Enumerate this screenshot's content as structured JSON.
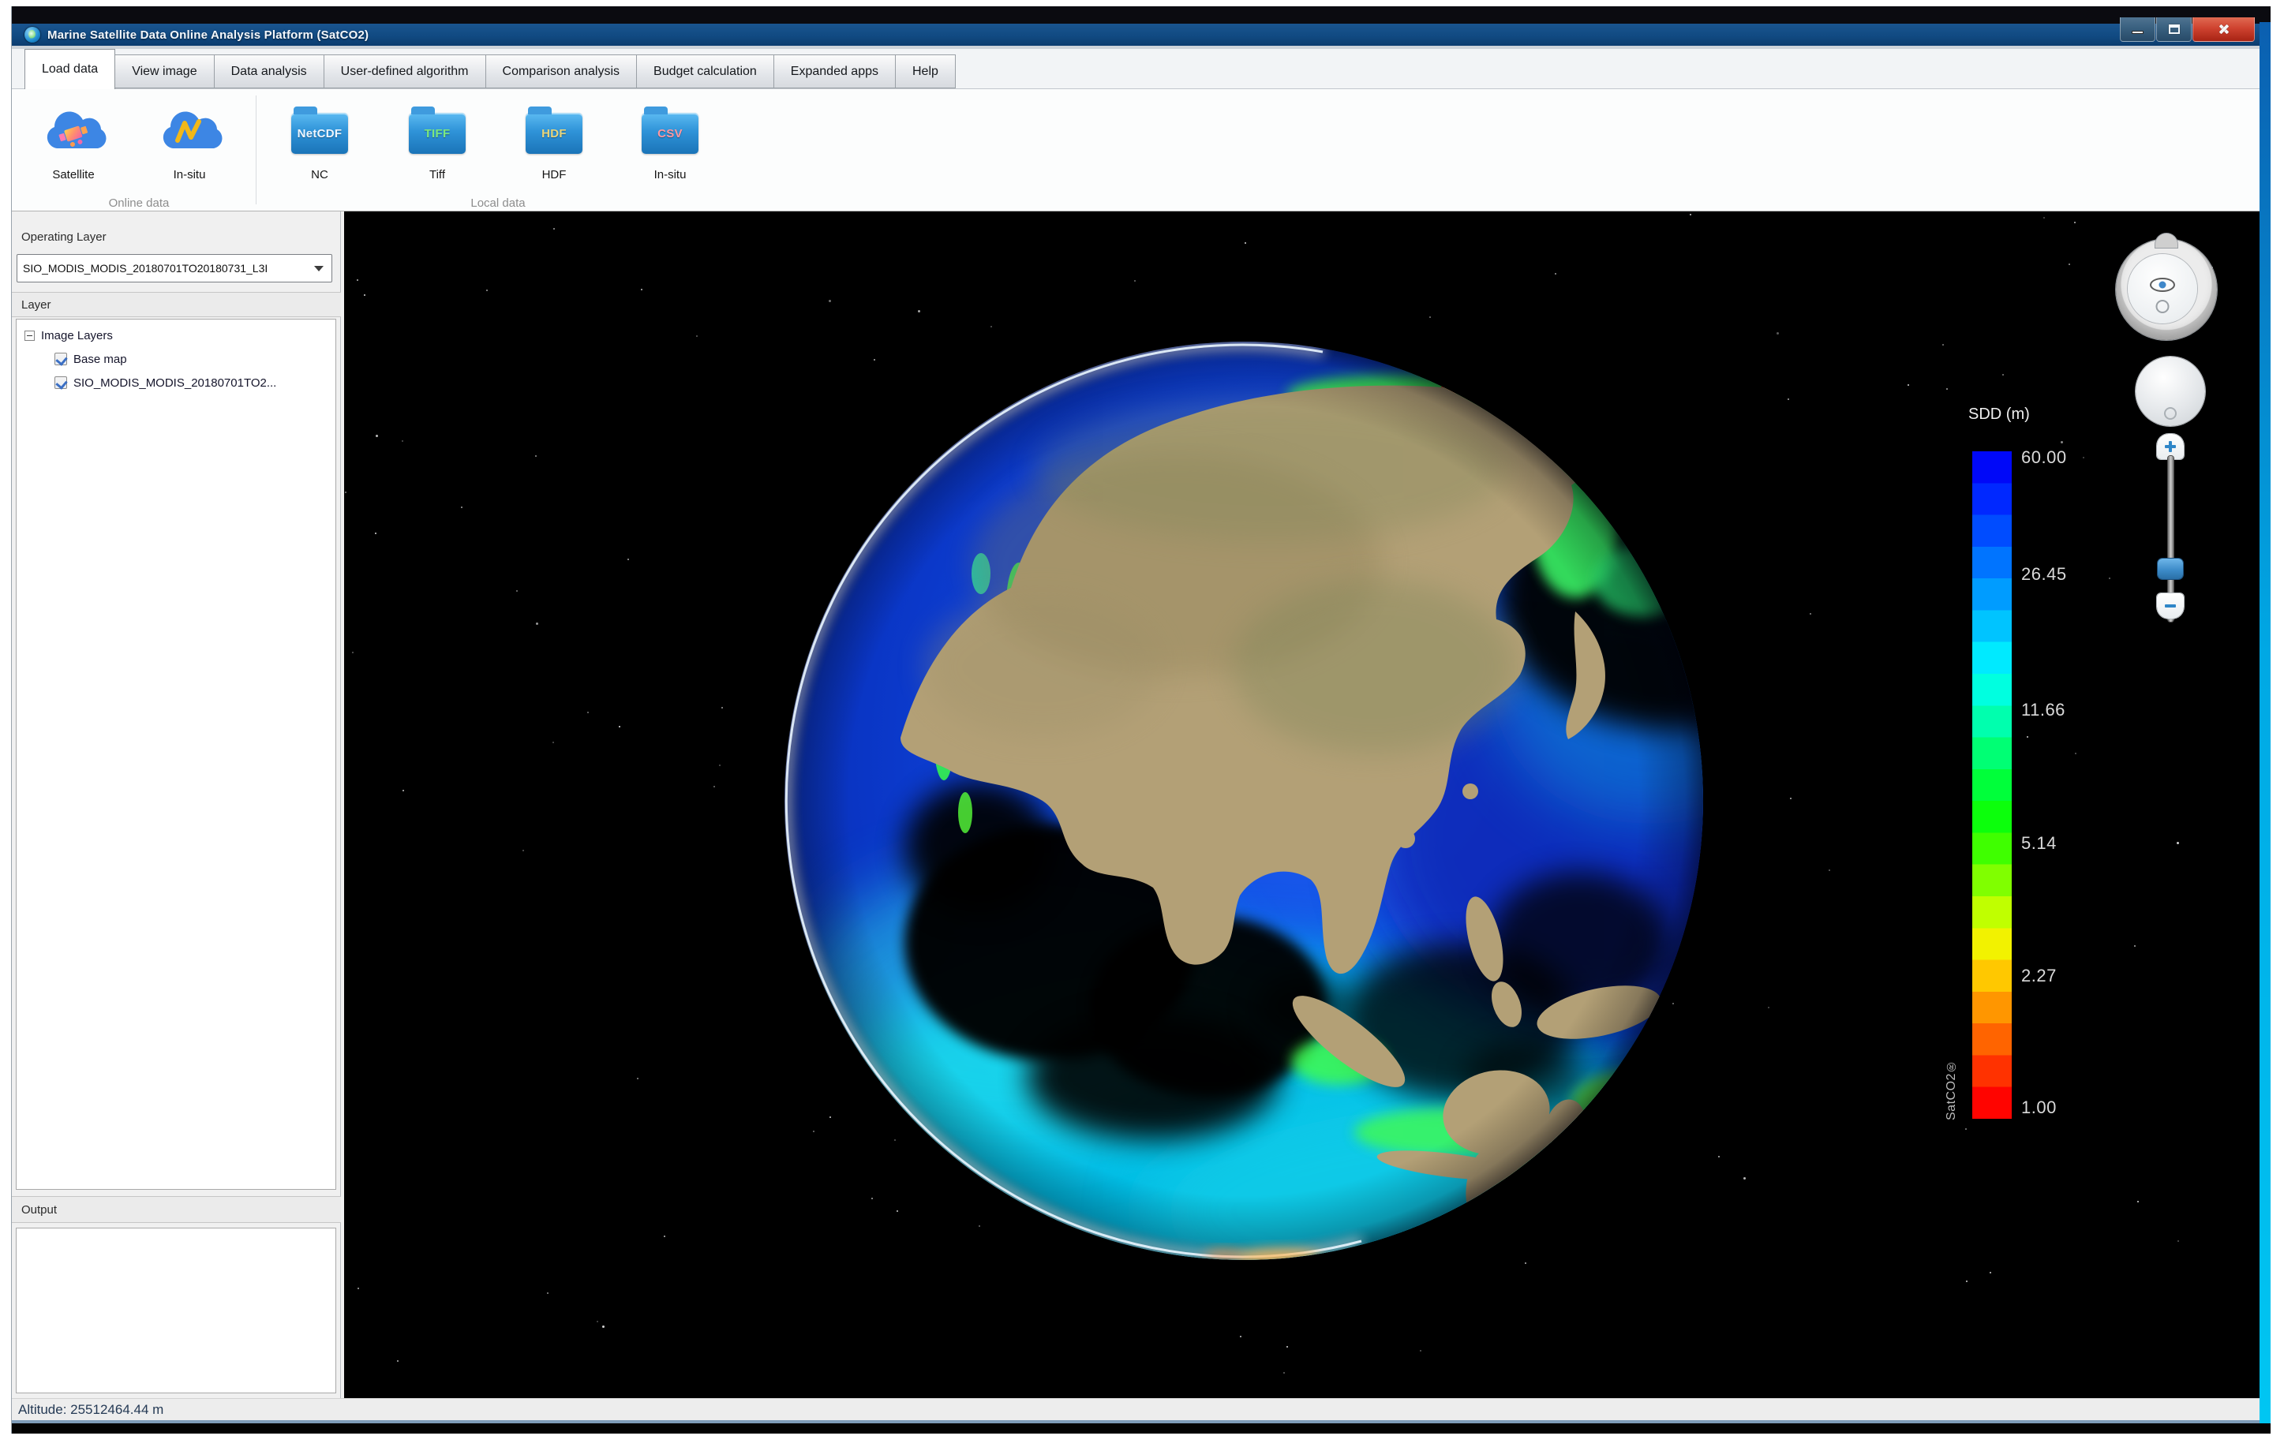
{
  "window": {
    "title": "Marine Satellite Data Online Analysis Platform (SatCO2)"
  },
  "tabs": [
    {
      "label": "Load data",
      "active": true
    },
    {
      "label": "View image"
    },
    {
      "label": "Data analysis"
    },
    {
      "label": "User-defined algorithm"
    },
    {
      "label": "Comparison analysis"
    },
    {
      "label": "Budget calculation"
    },
    {
      "label": "Expanded apps"
    },
    {
      "label": "Help"
    }
  ],
  "toolbar": {
    "groups": [
      {
        "caption": "Online data",
        "items": [
          {
            "label": "Satellite",
            "icon": "satellite-cloud-icon"
          },
          {
            "label": "In-situ",
            "icon": "insitu-cloud-icon"
          }
        ]
      },
      {
        "caption": "Local data",
        "items": [
          {
            "label": "NC",
            "badge": "NetCDF",
            "badge_color": "#eef6ff"
          },
          {
            "label": "Tiff",
            "badge": "TIFF",
            "badge_color": "#7de87d"
          },
          {
            "label": "HDF",
            "badge": "HDF",
            "badge_color": "#e9d57a"
          },
          {
            "label": "In-situ",
            "badge": "CSV",
            "badge_color": "#ff97a0"
          }
        ]
      }
    ]
  },
  "sidebar": {
    "operating_layer_label": "Operating Layer",
    "operating_layer_value": "SIO_MODIS_MODIS_20180701TO20180731_L3I",
    "layer_panel_label": "Layer",
    "tree_root": "Image Layers",
    "tree_items": [
      {
        "label": "Base map",
        "checked": true
      },
      {
        "label": "SIO_MODIS_MODIS_20180701TO2...",
        "checked": true
      }
    ],
    "output_panel_label": "Output"
  },
  "legend": {
    "title": "SDD (m)",
    "brand": "SatCO2®",
    "ticks": [
      {
        "label": "60.00",
        "pos": 0.9
      },
      {
        "label": "26.45",
        "pos": 18.4
      },
      {
        "label": "11.66",
        "pos": 38.8
      },
      {
        "label": "5.14",
        "pos": 58.7
      },
      {
        "label": "2.27",
        "pos": 78.6
      },
      {
        "label": "1.00",
        "pos": 98.3
      }
    ],
    "stops": [
      "#0008f8",
      "#0028ff",
      "#004cff",
      "#0074ff",
      "#009cff",
      "#00c4ff",
      "#00eaff",
      "#00ffe0",
      "#00ffae",
      "#00ff74",
      "#00ff3a",
      "#0cff0c",
      "#3fff00",
      "#80ff00",
      "#c0ff00",
      "#f2f200",
      "#ffc800",
      "#ff9600",
      "#ff6400",
      "#ff3200",
      "#ff0400"
    ]
  },
  "status": {
    "altitude": "Altitude: 25512464.44 m"
  },
  "colors": {
    "titlebar": "#114a82",
    "close_button": "#cf4330",
    "frame_accent": "#00b6ec"
  }
}
